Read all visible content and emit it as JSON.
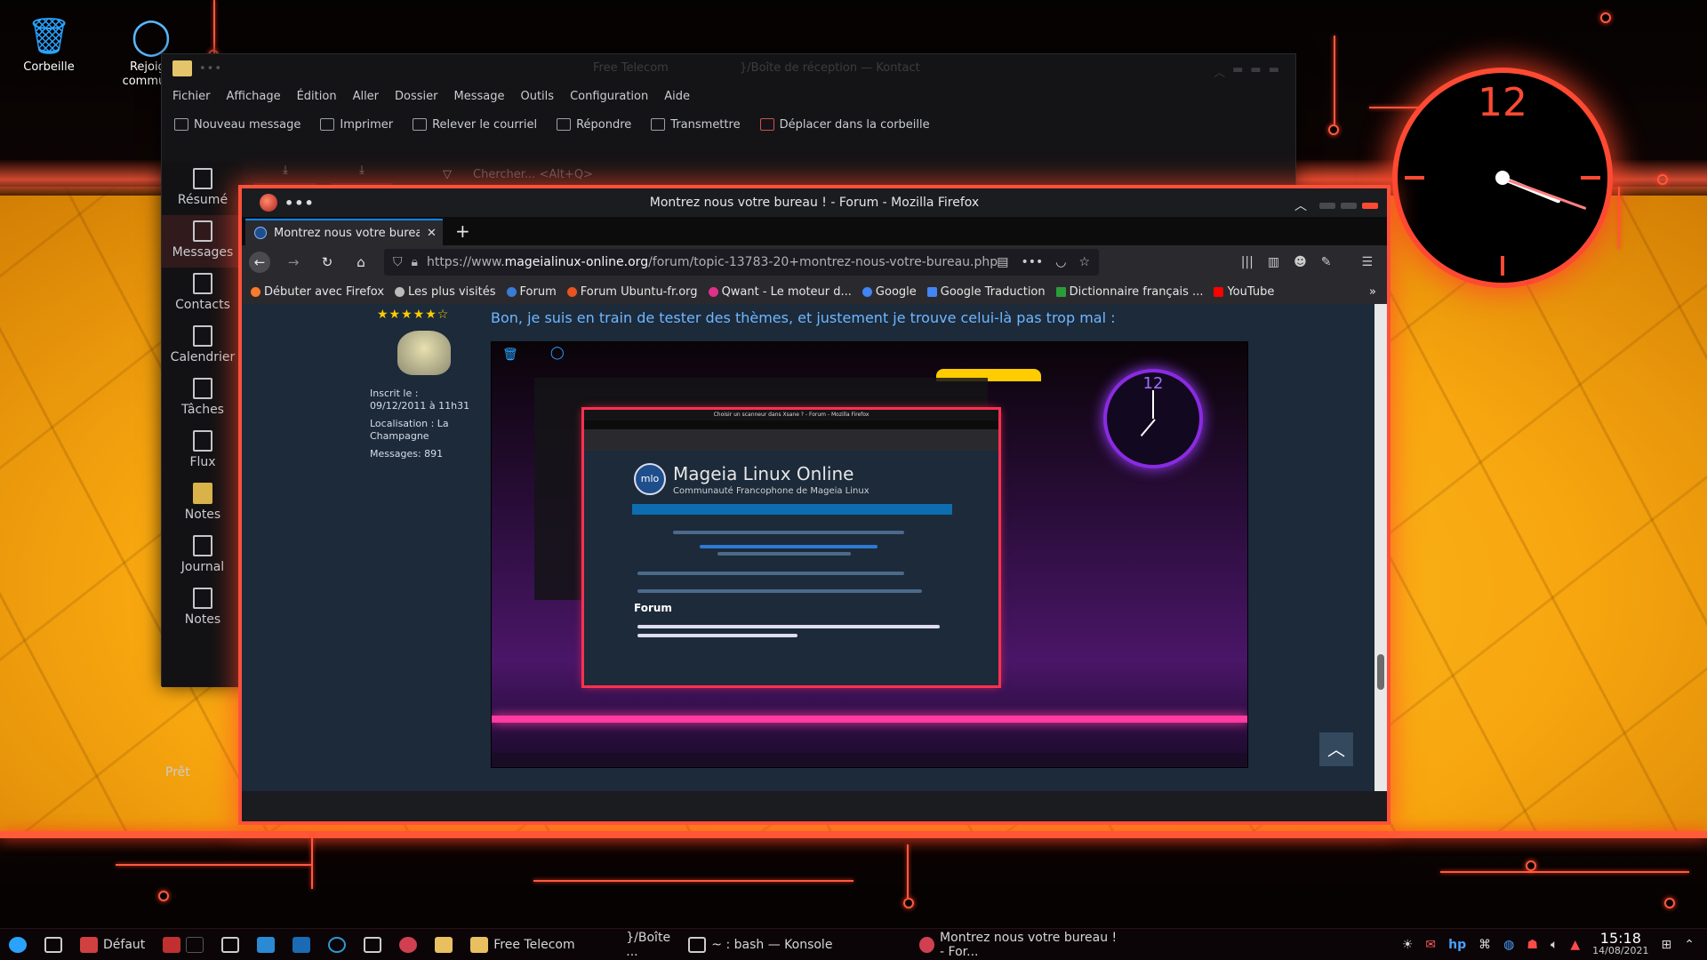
{
  "desktop": {
    "icons": [
      {
        "label": "Corbeille"
      },
      {
        "label": "Rejoignez la communauté",
        "short": "Rejoign communa"
      }
    ]
  },
  "clock_widget": {
    "number": "12"
  },
  "kontact": {
    "title_left": "Free Telecom",
    "title_right": "}/Boîte de réception — Kontact",
    "menu": [
      "Fichier",
      "Affichage",
      "Édition",
      "Aller",
      "Dossier",
      "Message",
      "Outils",
      "Configuration",
      "Aide"
    ],
    "toolbar": [
      "Nouveau message",
      "Imprimer",
      "Relever le courriel",
      "Répondre",
      "Transmettre",
      "Déplacer dans la corbeille"
    ],
    "search_placeholder": "Chercher... <Alt+Q>",
    "sidebar": [
      "Résumé",
      "Messages",
      "Contacts",
      "Calendrier",
      "Tâches",
      "Flux",
      "Notes",
      "Journal",
      "Notes"
    ],
    "active_sidebar": "Messages",
    "status": "Prêt"
  },
  "firefox": {
    "window_title": "Montrez nous votre bureau ! - Forum - Mozilla Firefox",
    "tab_title": "Montrez nous votre bureau ! - Forum",
    "url_prefix": "https://www.",
    "url_host": "mageialinux-online.org",
    "url_path": "/forum/topic-13783-20+montrez-nous-votre-bureau.php",
    "bookmarks": [
      {
        "label": "Débuter avec Firefox",
        "color": "#ff7a2a"
      },
      {
        "label": "Les plus visités",
        "color": "#bbbbbb"
      },
      {
        "label": "Forum",
        "color": "#3a7bd5"
      },
      {
        "label": "Forum Ubuntu-fr.org",
        "color": "#e95420"
      },
      {
        "label": "Qwant - Le moteur d...",
        "color": "#e0308a"
      },
      {
        "label": "Google",
        "color": "#4285f4"
      },
      {
        "label": "Google Traduction",
        "color": "#4285f4"
      },
      {
        "label": "Dictionnaire français ...",
        "color": "#2a9d3a"
      },
      {
        "label": "YouTube",
        "color": "#ff0000"
      }
    ],
    "post": {
      "stars": "★★★★★☆",
      "registered": "Inscrit le : 09/12/2011 à 11h31",
      "location": "Localisation : La Champagne",
      "messages": "Messages: 891",
      "text": "Bon, je suis en train de tester des thèmes, et justement je trouve celui-là pas trop mal :"
    },
    "embedded": {
      "site_title": "Mageia Linux Online",
      "site_subtitle": "Communauté Francophone de Mageia Linux",
      "forum_heading": "Forum",
      "logo_text": "mlo",
      "clock_number": "12",
      "window_title": "Choisir un scanneur dans Xsane ? - Forum - Mozilla Firefox"
    }
  },
  "taskbar": {
    "activity": "Défaut",
    "tasks": [
      "Free Telecom",
      "}/Boîte ...",
      "~ : bash — Konsole",
      "Montrez nous votre bureau ! - For..."
    ],
    "time": "15:18",
    "date": "14/08/2021"
  }
}
